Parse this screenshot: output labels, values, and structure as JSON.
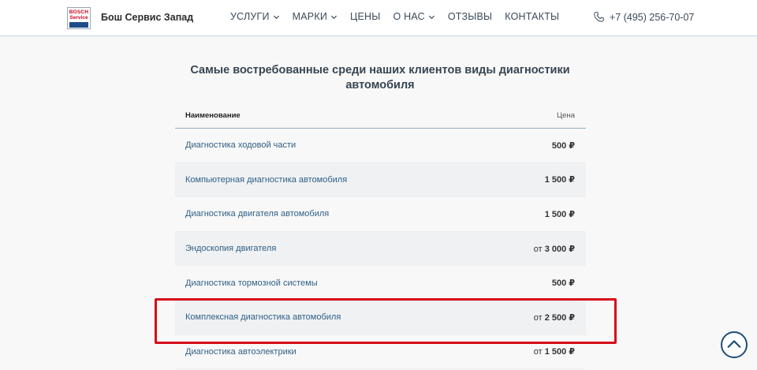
{
  "header": {
    "logo_line1": "BOSCH",
    "logo_line2": "Service",
    "brand": "Бош Сервис Запад",
    "nav": [
      {
        "label": "УСЛУГИ",
        "dropdown": true
      },
      {
        "label": "МАРКИ",
        "dropdown": true
      },
      {
        "label": "ЦЕНЫ",
        "dropdown": false
      },
      {
        "label": "О НАС",
        "dropdown": true
      },
      {
        "label": "ОТЗЫВЫ",
        "dropdown": false
      },
      {
        "label": "КОНТАКТЫ",
        "dropdown": false
      }
    ],
    "phone": "+7 (495) 256-70-07"
  },
  "section": {
    "title_line1": "Самые востребованные среди наших клиентов виды диагностики",
    "title_line2": "автомобиля"
  },
  "table": {
    "col_name": "Наименование",
    "col_price": "Цена",
    "rows": [
      {
        "name": "Диагностика ходовой части",
        "prefix": "",
        "amount": "500 ₽"
      },
      {
        "name": "Компьютерная диагностика автомобиля",
        "prefix": "",
        "amount": "1 500 ₽"
      },
      {
        "name": "Диагностика двигателя автомобиля",
        "prefix": "",
        "amount": "1 500 ₽"
      },
      {
        "name": "Эндоскопия двигателя",
        "prefix": "от ",
        "amount": "3 000 ₽"
      },
      {
        "name": "Диагностика тормозной системы",
        "prefix": "",
        "amount": "500 ₽"
      },
      {
        "name": "Комплексная диагностика автомобиля",
        "prefix": "от ",
        "amount": "2 500 ₽"
      },
      {
        "name": "Диагностика автоэлектрики",
        "prefix": "от ",
        "amount": "1 500 ₽"
      }
    ]
  },
  "colors": {
    "accent": "#1f4e79",
    "link": "#2f5f86",
    "highlight": "#d60a1a"
  }
}
